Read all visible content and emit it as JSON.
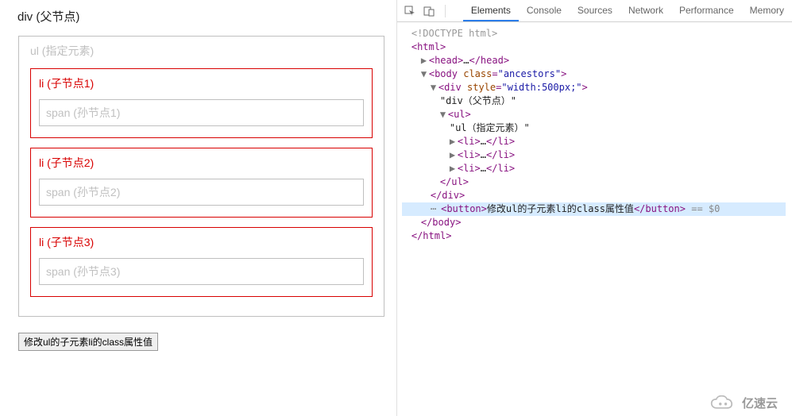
{
  "left": {
    "div_label": "div (父节点)",
    "ul_label": "ul (指定元素)",
    "li": [
      "li (子节点1)",
      "li (子节点2)",
      "li (子节点3)"
    ],
    "span": [
      "span (孙节点1)",
      "span (孙节点2)",
      "span (孙节点3)"
    ],
    "button_label": "修改ul的子元素li的class属性值"
  },
  "dev": {
    "tabs": [
      "Elements",
      "Console",
      "Sources",
      "Network",
      "Performance",
      "Memory"
    ],
    "active_tab_index": 0,
    "doctype": "<!DOCTYPE html>",
    "html_open": "html",
    "head": {
      "open": "head",
      "ellipsis": "…",
      "close": "/head"
    },
    "body": {
      "open": "body",
      "attr_class_name": "class",
      "attr_class_val": "ancestors"
    },
    "div": {
      "open": "div",
      "attr_style_name": "style",
      "attr_style_val": "width:500px;",
      "text": "\"div（父节点）\""
    },
    "ul": {
      "open": "ul",
      "text": "\"ul（指定元素）\"",
      "close": "/ul"
    },
    "li_open": "li",
    "li_ellipsis": "…",
    "li_close": "/li",
    "div_close": "/div",
    "button_node": {
      "open": "button",
      "text": "修改ul的子元素li的class属性值",
      "close": "/button",
      "eq": "== $0"
    },
    "body_close": "/body",
    "html_close": "/html"
  },
  "watermark": "亿速云"
}
